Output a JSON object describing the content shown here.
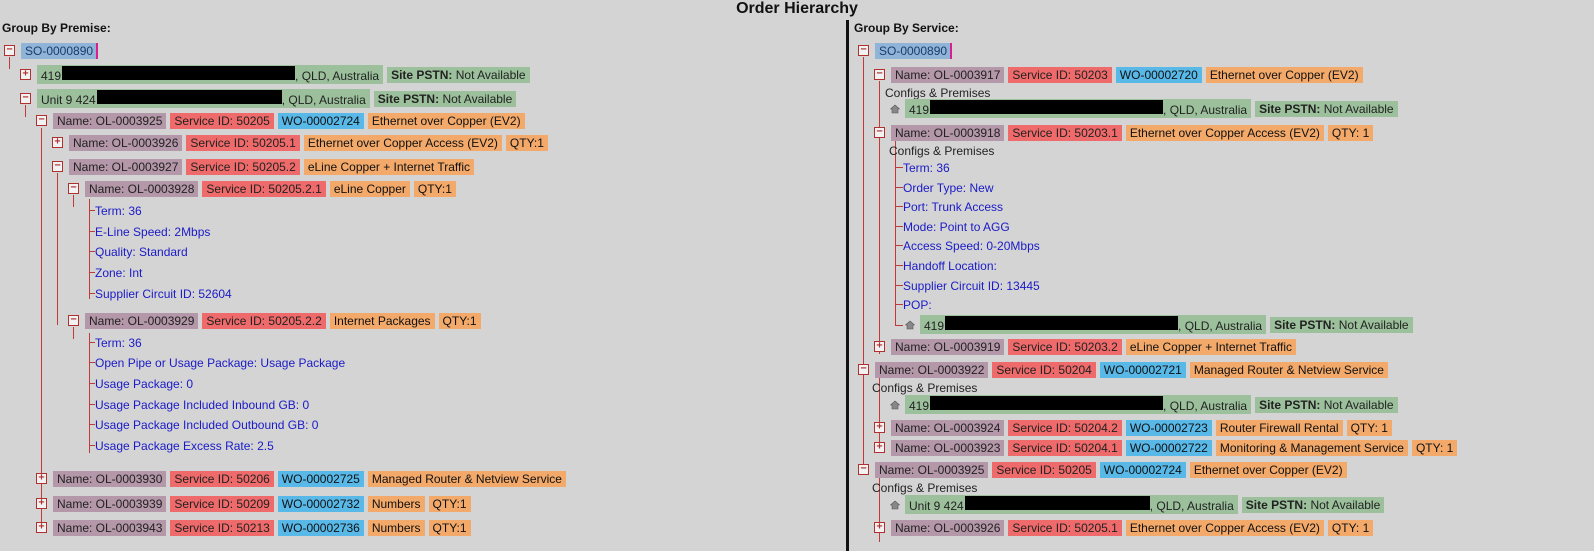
{
  "page": {
    "title": "Order Hierarchy"
  },
  "left": {
    "label": "Group By Premise:",
    "so": "SO-0000890",
    "premise1": {
      "num": "419",
      "suffix": ", QLD, Australia",
      "pstn_label": "Site PSTN:",
      "pstn_value": "Not Available"
    },
    "premise2": {
      "num": "Unit 9 424",
      "suffix": ", QLD, Australia",
      "pstn_label": "Site PSTN:",
      "pstn_value": "Not Available"
    },
    "r1": {
      "name": "Name: OL-0003925",
      "sid": "Service ID: 50205",
      "wo": "WO-00002724",
      "prod": "Ethernet over Copper (EV2)"
    },
    "r2": {
      "name": "Name: OL-0003926",
      "sid": "Service ID: 50205.1",
      "prod": "Ethernet over Copper Access (EV2)",
      "qty": "QTY:1"
    },
    "r3": {
      "name": "Name: OL-0003927",
      "sid": "Service ID: 50205.2",
      "prod": "eLine Copper + Internet Traffic"
    },
    "r4": {
      "name": "Name: OL-0003928",
      "sid": "Service ID: 50205.2.1",
      "prod": "eLine Copper",
      "qty": "QTY:1"
    },
    "cfg1": [
      "Term: 36",
      "E-Line Speed: 2Mbps",
      "Quality: Standard",
      "Zone: Int",
      "Supplier Circuit ID: 52604"
    ],
    "r5": {
      "name": "Name: OL-0003929",
      "sid": "Service ID: 50205.2.2",
      "prod": "Internet Packages",
      "qty": "QTY:1"
    },
    "cfg2": [
      "Term: 36",
      "Open Pipe or Usage Package: Usage Package",
      "Usage Package: 0",
      "Usage Package Included Inbound GB: 0",
      "Usage Package Included Outbound GB: 0",
      "Usage Package Excess Rate: 2.5"
    ],
    "r6": {
      "name": "Name: OL-0003930",
      "sid": "Service ID: 50206",
      "wo": "WO-00002725",
      "prod": "Managed Router & Netview Service"
    },
    "r7": {
      "name": "Name: OL-0003939",
      "sid": "Service ID: 50209",
      "wo": "WO-00002732",
      "prod": "Numbers",
      "qty": "QTY:1"
    },
    "r8": {
      "name": "Name: OL-0003943",
      "sid": "Service ID: 50213",
      "wo": "WO-00002736",
      "prod": "Numbers",
      "qty": "QTY:1"
    }
  },
  "right": {
    "label": "Group By Service:",
    "so": "SO-0000890",
    "configs_label": "Configs & Premises",
    "addr": {
      "num": "419",
      "unit": "Unit 9 424",
      "suffix": ", QLD, Australia",
      "pstn_label": "Site PSTN:",
      "pstn_value": "Not Available"
    },
    "a": {
      "name": "Name: OL-0003917",
      "sid": "Service ID: 50203",
      "wo": "WO-00002720",
      "prod": "Ethernet over Copper (EV2)"
    },
    "b": {
      "name": "Name: OL-0003918",
      "sid": "Service ID: 50203.1",
      "prod": "Ethernet over Copper Access (EV2)",
      "qty": "QTY: 1"
    },
    "bcfg": [
      "Term: 36",
      "Order Type: New",
      "Port: Trunk Access",
      "Mode: Point to AGG",
      "Access Speed: 0-20Mbps",
      "Handoff Location:",
      "Supplier Circuit ID: 13445",
      "POP:"
    ],
    "c": {
      "name": "Name: OL-0003919",
      "sid": "Service ID: 50203.2",
      "prod": "eLine Copper + Internet Traffic"
    },
    "d": {
      "name": "Name: OL-0003922",
      "sid": "Service ID: 50204",
      "wo": "WO-00002721",
      "prod": "Managed Router & Netview Service"
    },
    "e": {
      "name": "Name: OL-0003924",
      "sid": "Service ID: 50204.2",
      "wo": "WO-00002723",
      "prod": "Router Firewall Rental",
      "qty": "QTY: 1"
    },
    "f": {
      "name": "Name: OL-0003923",
      "sid": "Service ID: 50204.1",
      "wo": "WO-00002722",
      "prod": "Monitoring & Management Service",
      "qty": "QTY: 1"
    },
    "g": {
      "name": "Name: OL-0003925",
      "sid": "Service ID: 50205",
      "wo": "WO-00002724",
      "prod": "Ethernet over Copper (EV2)"
    },
    "h": {
      "name": "Name: OL-0003926",
      "sid": "Service ID: 50205.1",
      "prod": "Ethernet over Copper Access (EV2)",
      "qty": "QTY: 1"
    }
  }
}
